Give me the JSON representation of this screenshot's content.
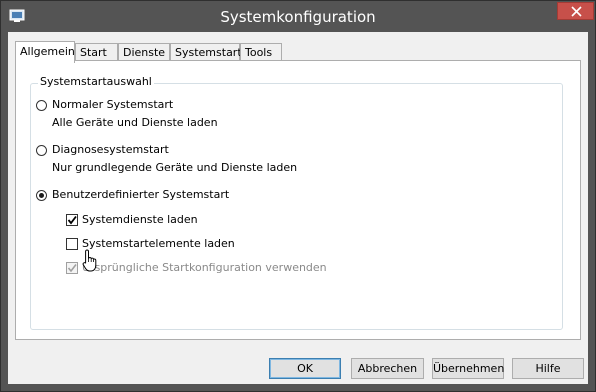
{
  "window": {
    "title": "Systemkonfiguration",
    "icon": "msconfig-icon",
    "close_icon": "close-icon"
  },
  "tabs": [
    {
      "label": "Allgemein",
      "active": true
    },
    {
      "label": "Start",
      "active": false
    },
    {
      "label": "Dienste",
      "active": false
    },
    {
      "label": "Systemstart",
      "active": false
    },
    {
      "label": "Tools",
      "active": false
    }
  ],
  "group": {
    "legend": "Systemstartauswahl",
    "options": [
      {
        "label": "Normaler Systemstart",
        "description": "Alle Geräte und Dienste laden",
        "selected": false
      },
      {
        "label": "Diagnosesystemstart",
        "description": "Nur grundlegende Geräte und Dienste laden",
        "selected": false
      },
      {
        "label": "Benutzerdefinierter Systemstart",
        "selected": true
      }
    ],
    "checkboxes": [
      {
        "label": "Systemdienste laden",
        "checked": true,
        "enabled": true
      },
      {
        "label": "Systemstartelemente laden",
        "checked": false,
        "enabled": true
      },
      {
        "label": "Ursprüngliche Startkonfiguration verwenden",
        "checked": true,
        "enabled": false
      }
    ]
  },
  "buttons": {
    "ok": "OK",
    "cancel": "Abbrechen",
    "apply": "Übernehmen",
    "help": "Hilfe"
  },
  "colors": {
    "titlebar": "#545454",
    "close": "#c7504a",
    "client": "#f0f0f0"
  }
}
